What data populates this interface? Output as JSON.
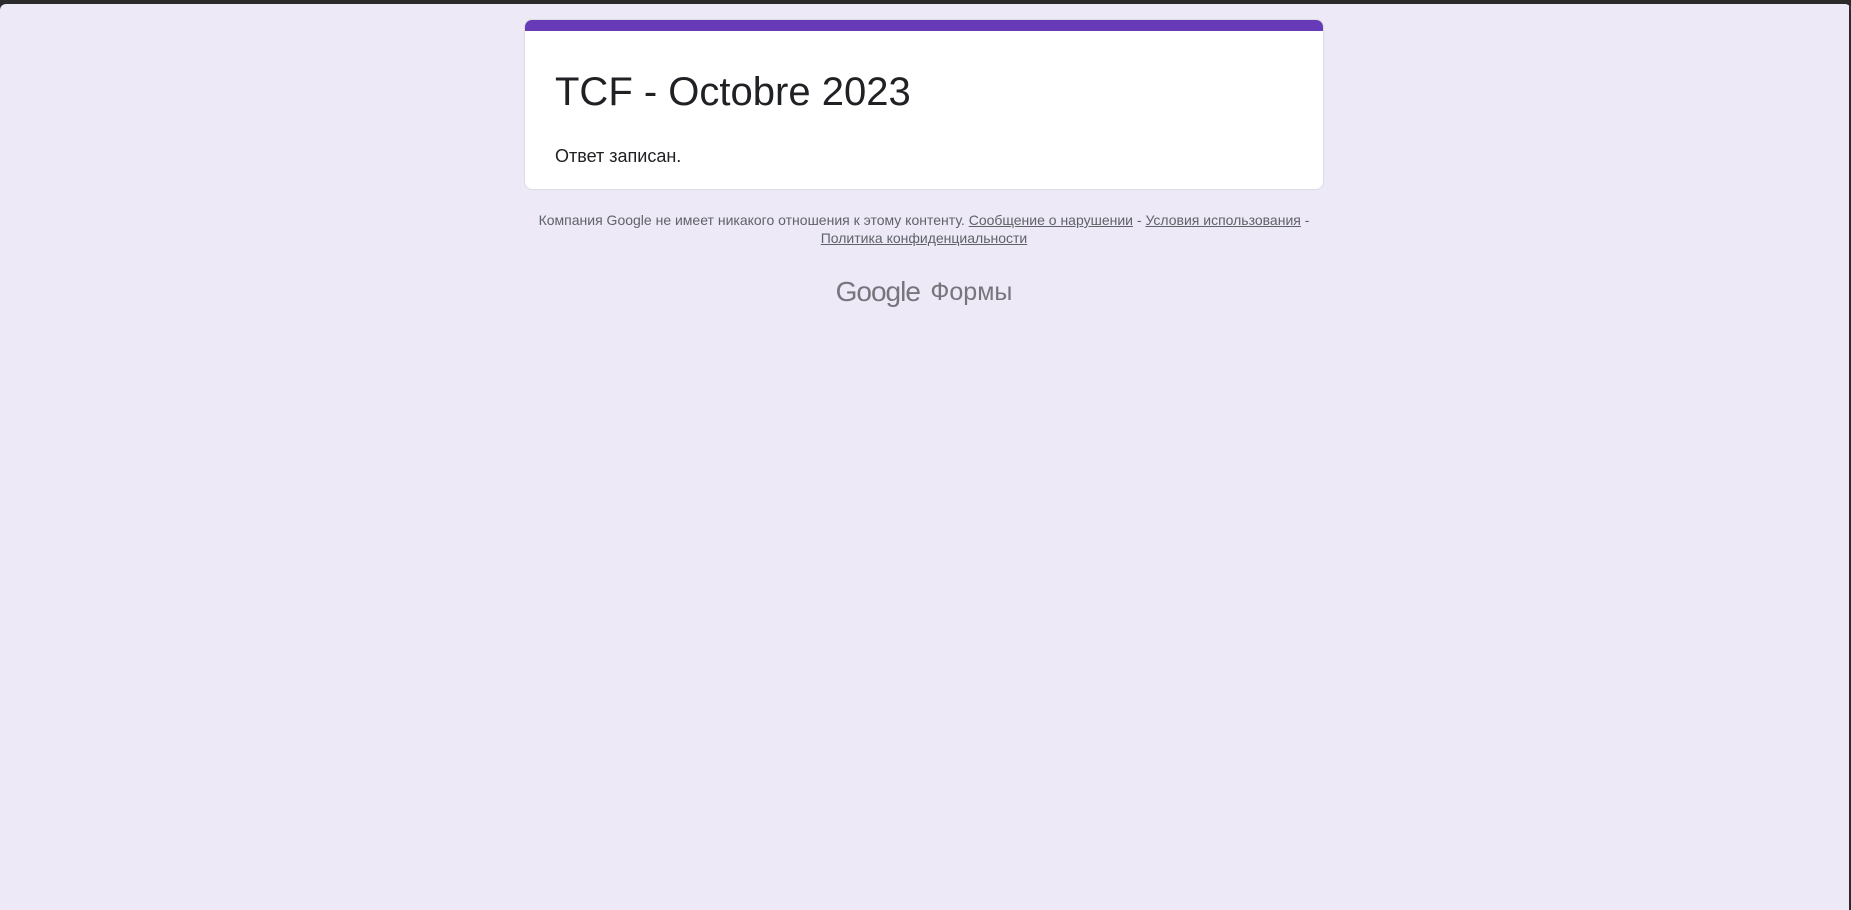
{
  "form": {
    "title": "TCF - Octobre 2023",
    "confirmation": "Ответ записан."
  },
  "footer": {
    "disclaimer": "Компания Google не имеет никакого отношения к этому контенту.",
    "separator": "-",
    "report_abuse": "Сообщение о нарушении",
    "terms": "Условия использования",
    "privacy": "Политика конфиденциальности"
  },
  "brand": {
    "google": "Google",
    "product": "Формы"
  },
  "colors": {
    "accent": "#673ab7",
    "background": "#ede9f7",
    "card": "#ffffff",
    "text": "#202124",
    "muted": "#5f6368"
  }
}
